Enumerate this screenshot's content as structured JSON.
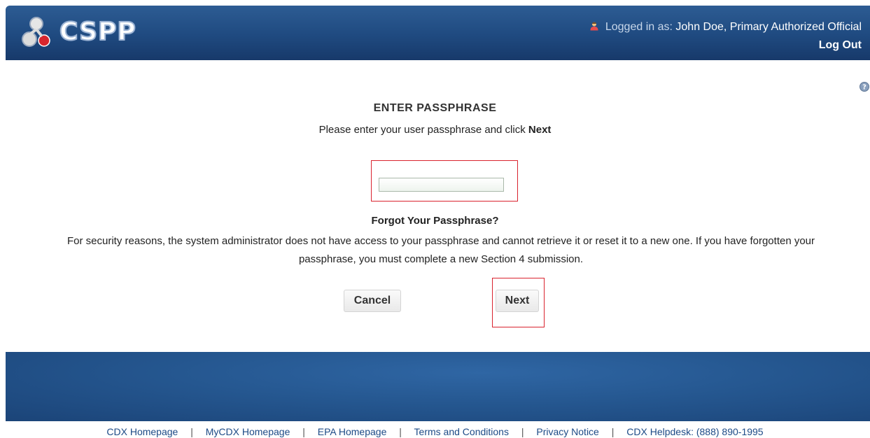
{
  "header": {
    "app_name": "CSPP",
    "logged_in_label": "Logged in as:",
    "user_name": "John Doe, Primary Authorized Official",
    "logout_label": "Log Out"
  },
  "main": {
    "title": "ENTER PASSPHRASE",
    "instruction_prefix": "Please enter your user passphrase and click",
    "instruction_bold": "Next",
    "passphrase_value": "",
    "forgot_title": "Forgot Your Passphrase?",
    "forgot_text": "For security reasons, the system administrator does not have access to your passphrase and cannot retrieve it or reset it to a new one. If you have forgotten your passphrase, you must complete a new Section 4 submission.",
    "cancel_label": "Cancel",
    "next_label": "Next"
  },
  "footer": {
    "links": [
      "CDX Homepage",
      "MyCDX Homepage",
      "EPA Homepage",
      "Terms and Conditions",
      "Privacy Notice"
    ],
    "helpdesk": "CDX Helpdesk: (888) 890-1995",
    "separator": "|"
  },
  "colors": {
    "header_bg": "#1f4a80",
    "highlight_border": "#d9232e",
    "footer_link": "#1c4a86"
  },
  "icons": [
    "cspp-logo-icon",
    "user-icon",
    "help-icon"
  ]
}
